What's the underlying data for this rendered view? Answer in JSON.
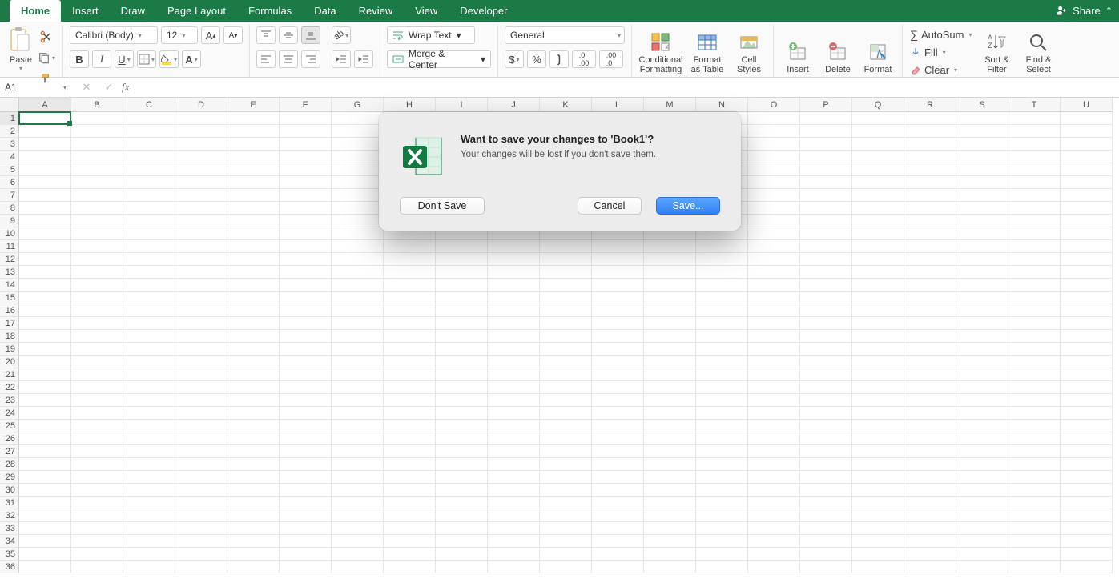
{
  "menubar": {
    "tabs": [
      "Home",
      "Insert",
      "Draw",
      "Page Layout",
      "Formulas",
      "Data",
      "Review",
      "View",
      "Developer"
    ],
    "active_index": 0,
    "share": "Share"
  },
  "ribbon": {
    "paste": "Paste",
    "font_name": "Calibri (Body)",
    "font_size": "12",
    "wrap_text": "Wrap Text",
    "merge_center": "Merge & Center",
    "number_format": "General",
    "cond_fmt_l1": "Conditional",
    "cond_fmt_l2": "Formatting",
    "fmt_table_l1": "Format",
    "fmt_table_l2": "as Table",
    "cell_styles_l1": "Cell",
    "cell_styles_l2": "Styles",
    "insert": "Insert",
    "delete": "Delete",
    "format": "Format",
    "autosum": "AutoSum",
    "fill": "Fill",
    "clear": "Clear",
    "sortfilter_l1": "Sort &",
    "sortfilter_l2": "Filter",
    "findsel_l1": "Find &",
    "findsel_l2": "Select"
  },
  "namebox": "A1",
  "columns": [
    "A",
    "B",
    "C",
    "D",
    "E",
    "F",
    "G",
    "H",
    "I",
    "J",
    "K",
    "L",
    "M",
    "N",
    "O",
    "P",
    "Q",
    "R",
    "S",
    "T",
    "U"
  ],
  "row_count": 36,
  "dialog": {
    "title": "Want to save your changes to 'Book1'?",
    "message": "Your changes will be lost if you don't save them.",
    "dont_save": "Don't Save",
    "cancel": "Cancel",
    "save": "Save..."
  }
}
